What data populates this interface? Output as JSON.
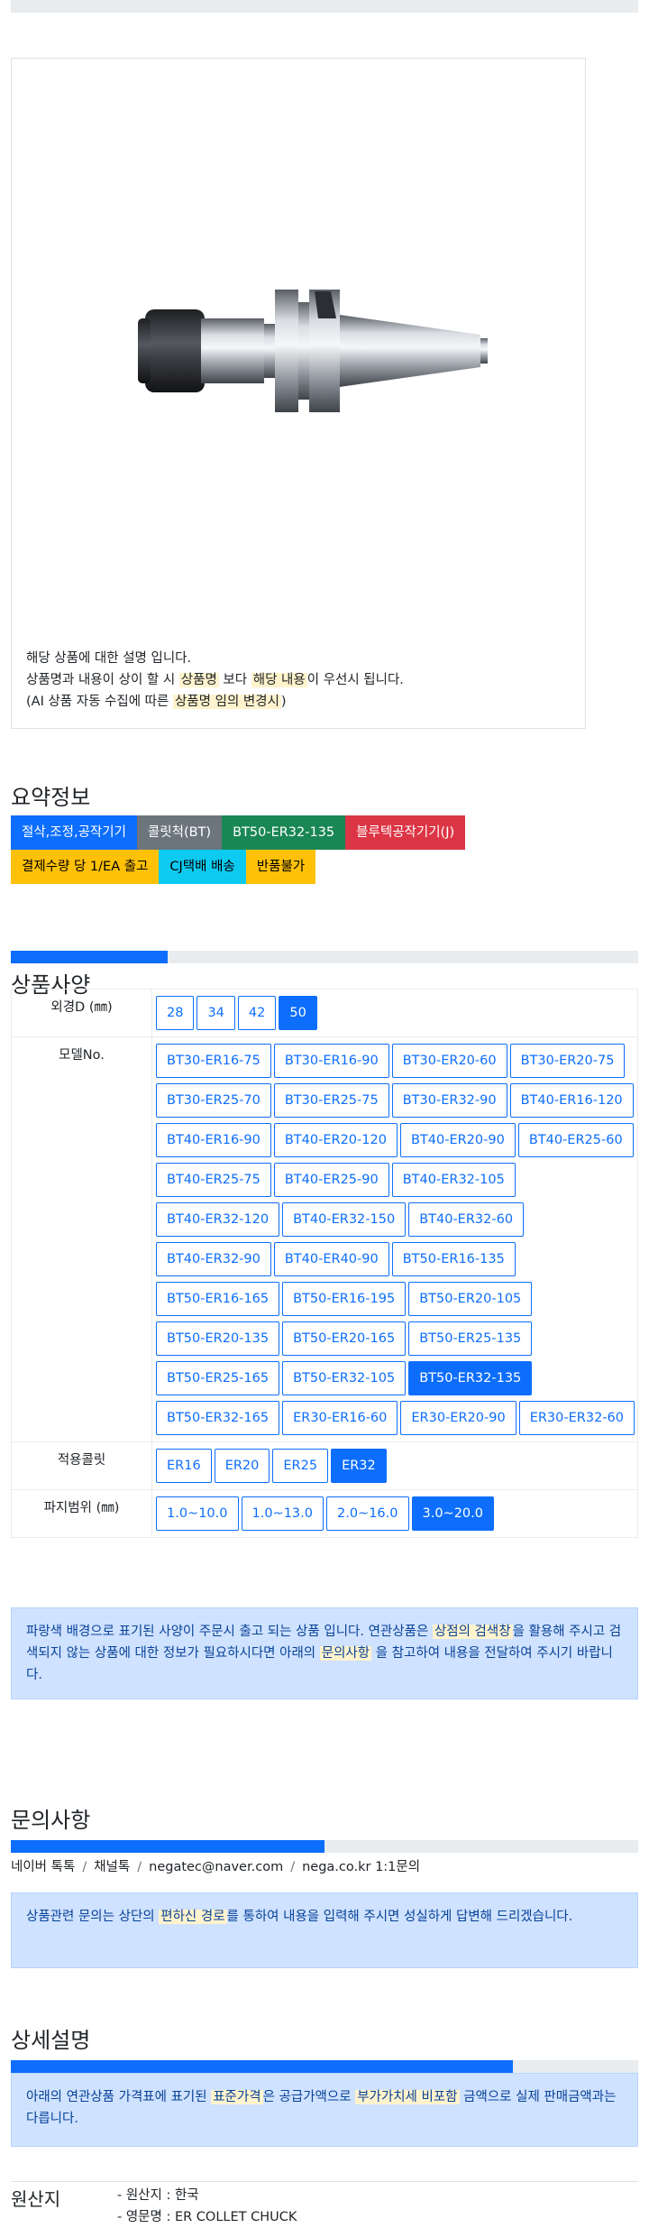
{
  "product": {
    "description": {
      "line1": "해당 상품에 대한 설명 입니다.",
      "line2_a": "상품명과 내용이 상이 할 시 ",
      "line2_hl1": "상품명",
      "line2_b": " 보다 ",
      "line2_hl2": "해당 내용",
      "line2_c": "이 우선시 됩니다.",
      "line3_a": "(AI 상품 자동 수집에 따른 ",
      "line3_hl": "상품명 임의 변경시",
      "line3_b": ")"
    }
  },
  "summary": {
    "title": "요약정보",
    "tags": [
      {
        "label": "절삭,조정,공작기기",
        "color": "#0d6efd"
      },
      {
        "label": "콜릿척(BT)",
        "color": "#6c757d"
      },
      {
        "label": "BT50-ER32-135",
        "color": "#198754"
      },
      {
        "label": "블루텍공작기기(J)",
        "color": "#dc3545"
      }
    ],
    "tags2": [
      {
        "label": "결제수량 당 1/EA 출고",
        "color": "#ffc107"
      },
      {
        "label": "CJ택배 배송",
        "color": "#0dcaf0"
      },
      {
        "label": "반품불가",
        "color": "#ffc107"
      }
    ]
  },
  "spec": {
    "title": "상품사양",
    "progress": 0.25,
    "rows": [
      {
        "label": "외경D (㎜)",
        "options": [
          "28",
          "34",
          "42",
          "50"
        ],
        "selected": "50"
      },
      {
        "label": "모델No.",
        "options": [
          "BT30-ER16-75",
          "BT30-ER16-90",
          "BT30-ER20-60",
          "BT30-ER20-75",
          "BT30-ER25-70",
          "BT30-ER25-75",
          "BT30-ER32-90",
          "BT40-ER16-120",
          "BT40-ER16-90",
          "BT40-ER20-120",
          "BT40-ER20-90",
          "BT40-ER25-60",
          "BT40-ER25-75",
          "BT40-ER25-90",
          "BT40-ER32-105",
          "BT40-ER32-120",
          "BT40-ER32-150",
          "BT40-ER32-60",
          "BT40-ER32-90",
          "BT40-ER40-90",
          "BT50-ER16-135",
          "BT50-ER16-165",
          "BT50-ER16-195",
          "BT50-ER20-105",
          "BT50-ER20-135",
          "BT50-ER20-165",
          "BT50-ER25-135",
          "BT50-ER25-165",
          "BT50-ER32-105",
          "BT50-ER32-135",
          "BT50-ER32-165",
          "ER30-ER16-60",
          "ER30-ER20-90",
          "ER30-ER32-60"
        ],
        "selected": "BT50-ER32-135"
      },
      {
        "label": "적용콜릿",
        "options": [
          "ER16",
          "ER20",
          "ER25",
          "ER32"
        ],
        "selected": "ER32"
      },
      {
        "label": "파지범위 (㎜)",
        "options": [
          "1.0~10.0",
          "1.0~13.0",
          "2.0~16.0",
          "3.0~20.0"
        ],
        "selected": "3.0~20.0"
      }
    ],
    "notice_a": "파랑색 배경으로 표기된 사양이 주문시 출고 되는 상품 입니다. 연관상품은 ",
    "notice_hl1": "상점의 검색창",
    "notice_b": "을 활용해 주시고 검색되지 않는 상품에 대한 정보가 필요하시다면 아래의 ",
    "notice_hl2": "문의사항",
    "notice_c": " 을 참고하여 내용을 전달하여 주시기 바랍니다."
  },
  "inquiry": {
    "title": "문의사항",
    "progress": 0.5,
    "channels": [
      "네이버 톡톡",
      "채널톡",
      "negatec@naver.com",
      "nega.co.kr 1:1문의"
    ],
    "notice_a": "상품관련 문의는 상단의 ",
    "notice_hl": "편하신 경로",
    "notice_b": "를 통하여 내용을 입력해 주시면 성실하게 답변해 드리겠습니다."
  },
  "detail": {
    "title": "상세설명",
    "progress": 0.8,
    "notice_a": "아래의 연관상품 가격표에 표기된 ",
    "notice_hl1": "표준가격",
    "notice_b": "은 공급가액으로 ",
    "notice_hl2": "부가가치세 비포함",
    "notice_c": " 금액으로 실제 판매금액과는 다릅니다."
  },
  "origin": {
    "title": "원산지",
    "lines": [
      "- 원산지 : 한국",
      "- 영문명 : ER COLLET CHUCK"
    ]
  }
}
